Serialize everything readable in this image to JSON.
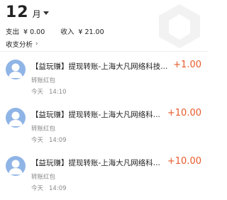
{
  "header": {
    "month_num": "12",
    "month_unit": "月",
    "expense_label": "支出",
    "expense_value": "¥ 0.00",
    "income_label": "收入",
    "income_value": "¥ 21.00",
    "analysis_label": "收支分析",
    "analysis_chevron": "›"
  },
  "colors": {
    "amount": "#e65a2b",
    "avatar": "#8fb4e6",
    "subtext": "#888888"
  },
  "transactions": [
    {
      "title": "【益玩赚】提现转账-上海大凡网络科技...",
      "amount": "+1.00",
      "category": "转账红包",
      "day": "今天",
      "time": "14:10",
      "icon": "user-avatar-icon"
    },
    {
      "title": "【益玩赚】提现转账-上海大凡网络科...",
      "amount": "+10.00",
      "category": "转账红包",
      "day": "今天",
      "time": "14:09",
      "icon": "user-avatar-icon"
    },
    {
      "title": "【益玩赚】提现转账-上海大凡网络科...",
      "amount": "+10.00",
      "category": "转账红包",
      "day": "今天",
      "time": "14:09",
      "icon": "user-avatar-icon"
    }
  ]
}
